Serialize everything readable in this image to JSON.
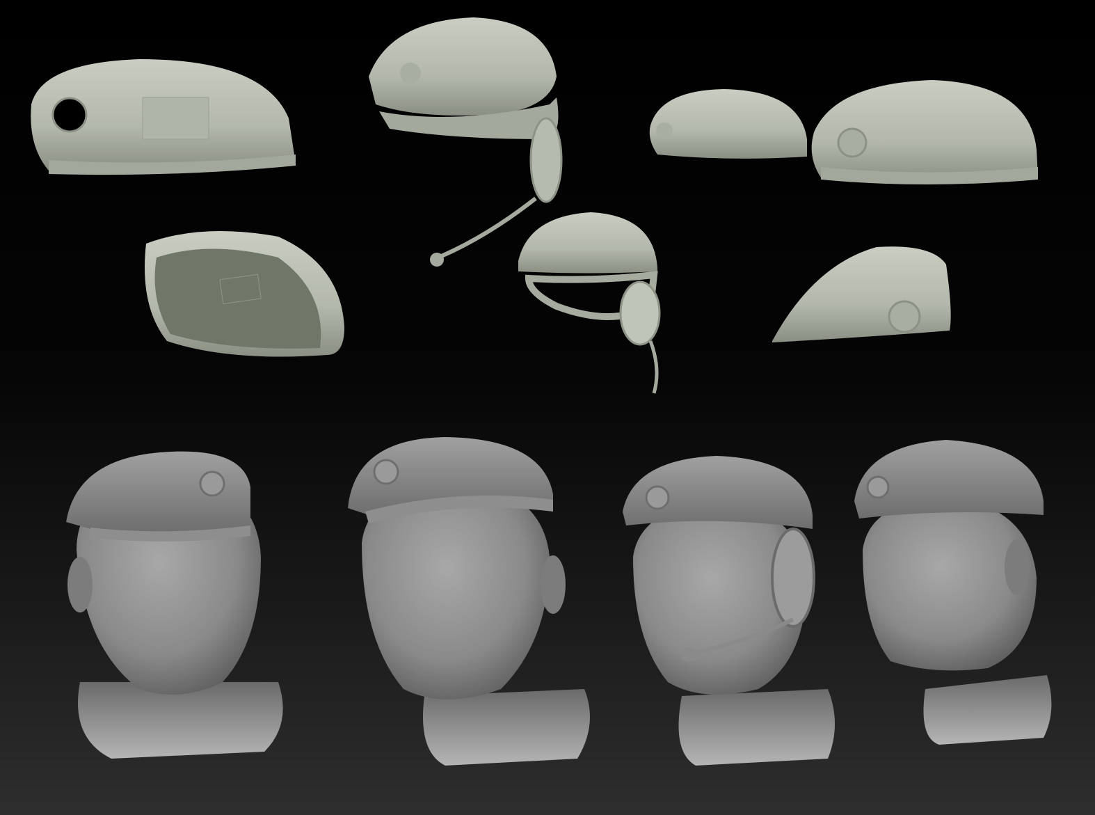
{
  "scene": {
    "subject": "beret-sculpt-sheet",
    "colors": {
      "beret": "#b9bdb2",
      "beret_shadow": "#7f857a",
      "head": "#8c8c8c",
      "head_light": "#b0b0b0",
      "head_shadow": "#555555",
      "background_top": "#000000",
      "background_bottom": "#2e2e2e"
    }
  }
}
